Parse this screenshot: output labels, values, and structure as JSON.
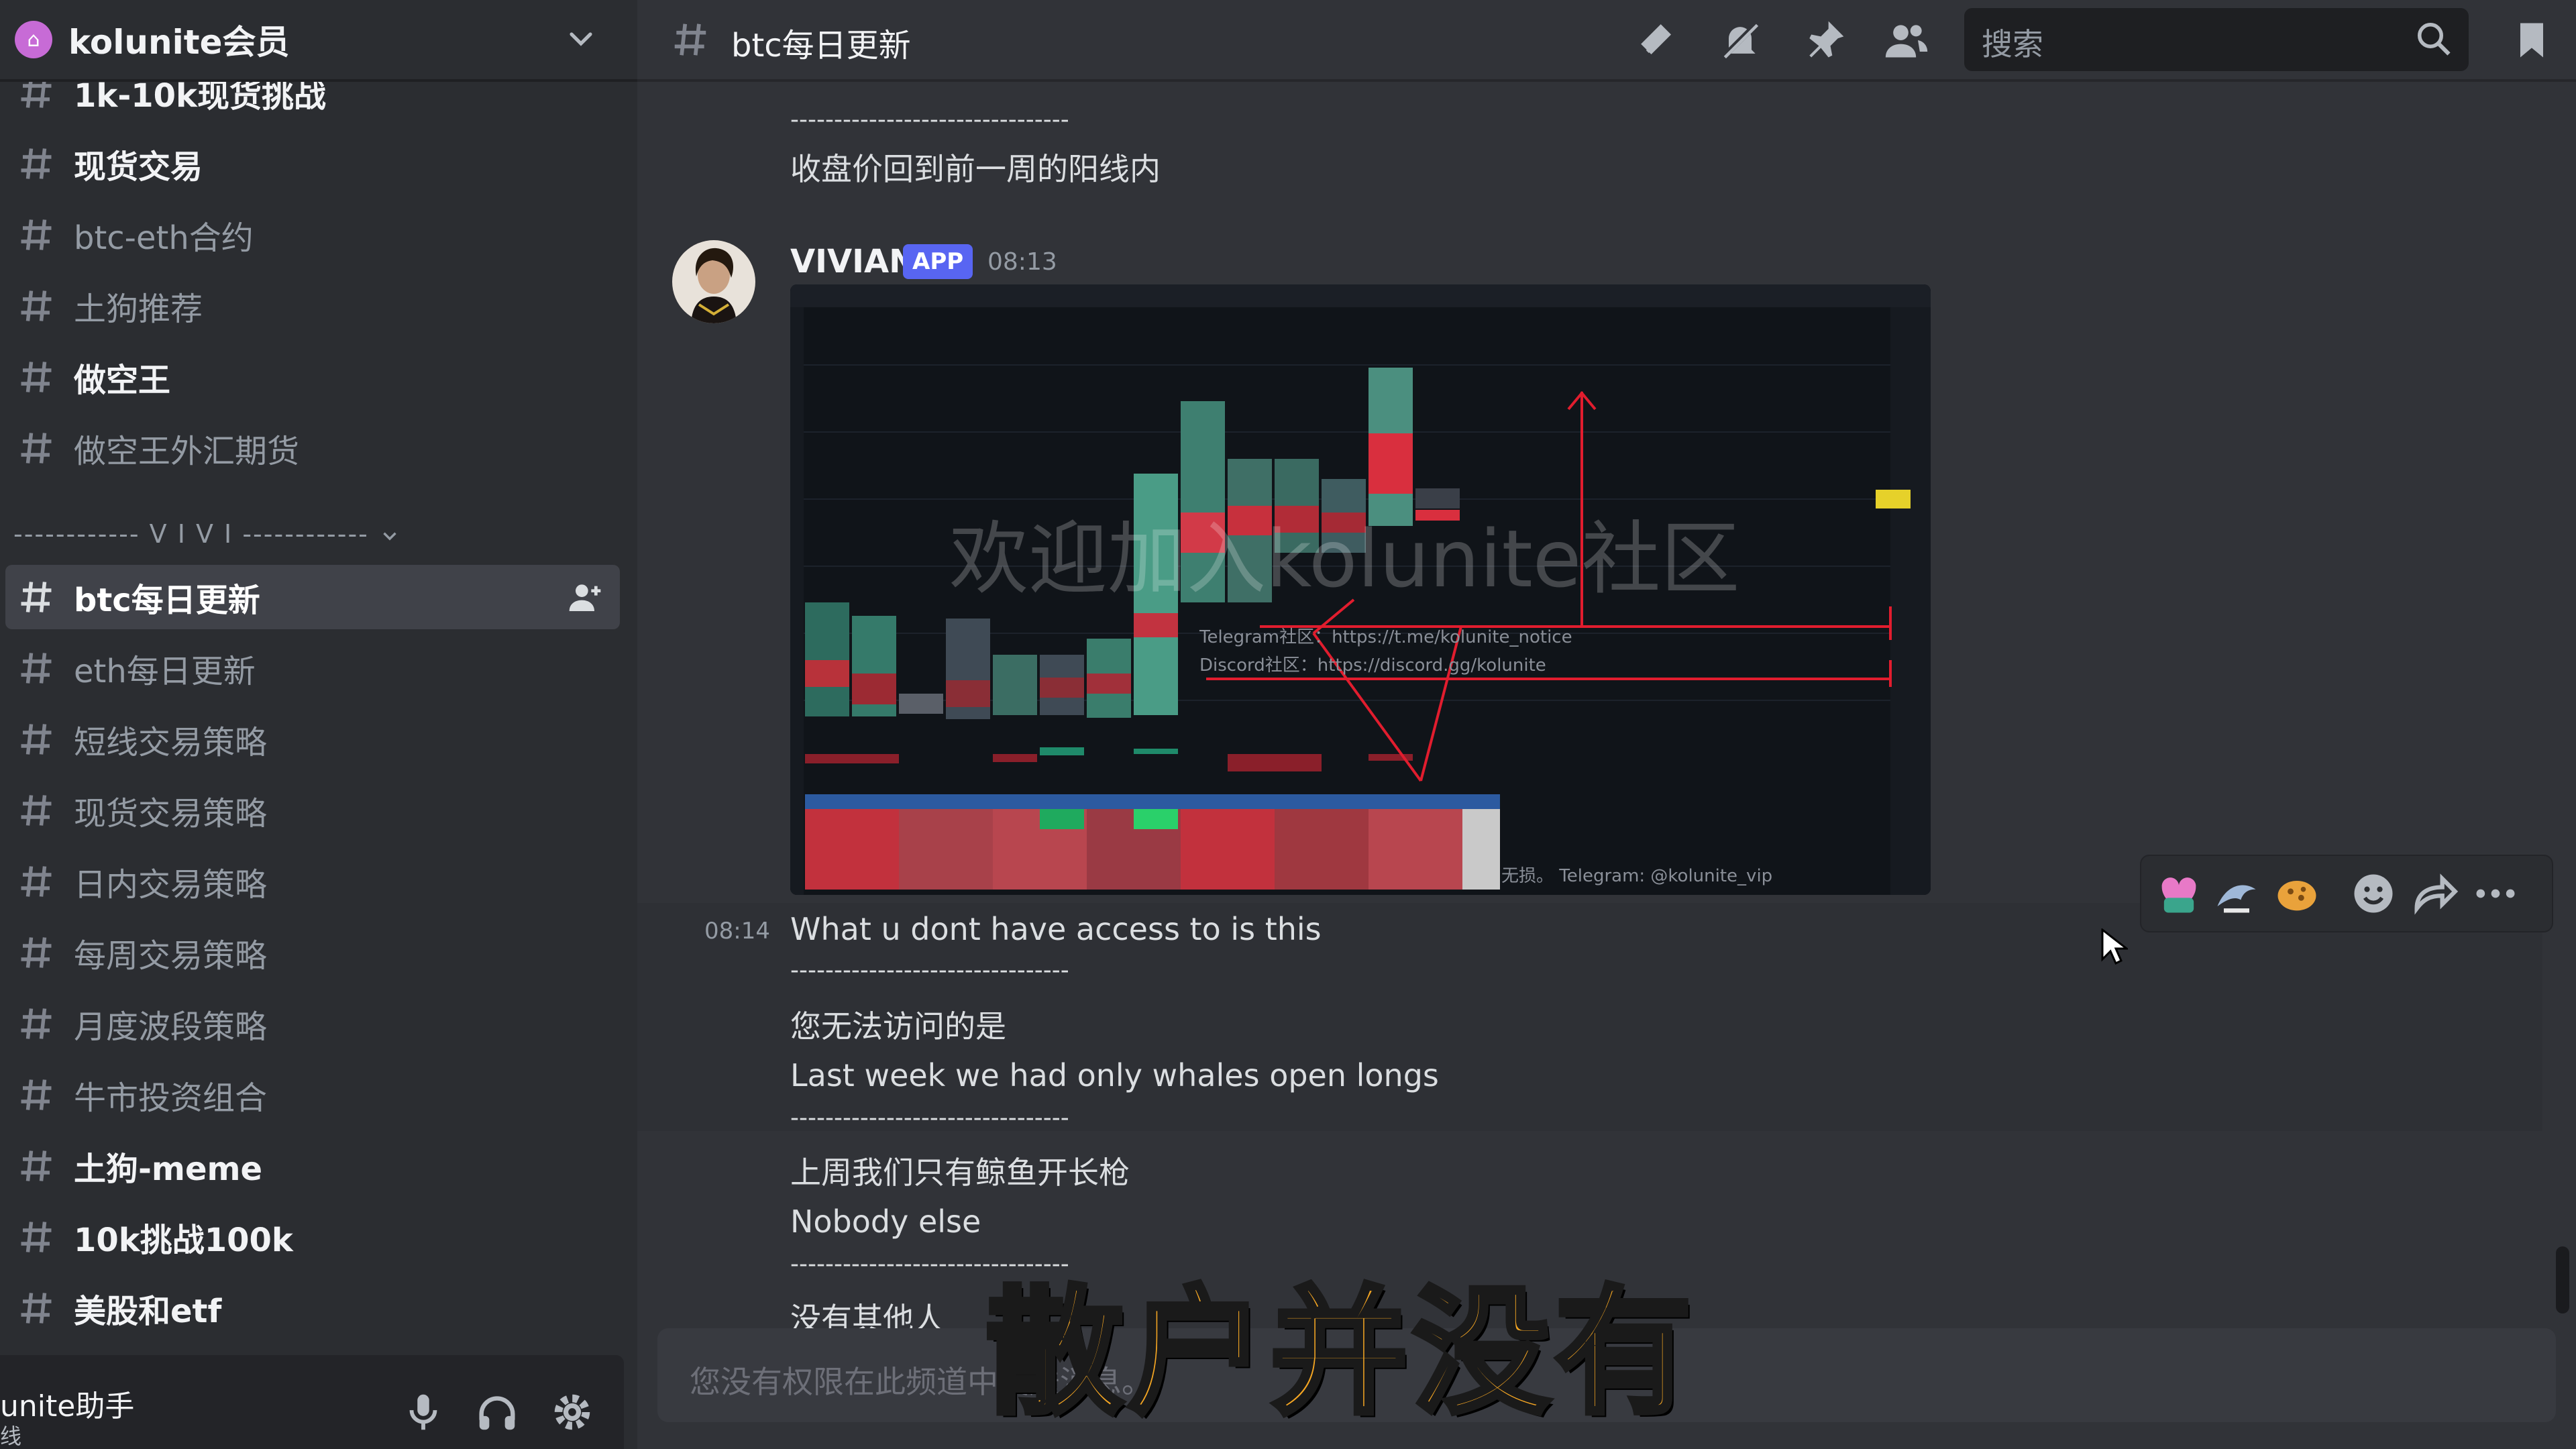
{
  "server": {
    "name": "kolunite会员"
  },
  "channels_top": [
    {
      "label": "1k-10k现货挑战",
      "unread": true
    },
    {
      "label": "现货交易",
      "unread": true
    },
    {
      "label": "btc-eth合约",
      "unread": false
    },
    {
      "label": "土狗推荐",
      "unread": false
    },
    {
      "label": "做空王",
      "unread": true
    },
    {
      "label": "做空王外汇期货",
      "unread": false
    }
  ],
  "category": {
    "label": "------------ V I V I ------------"
  },
  "channels_vivi": [
    {
      "label": "btc每日更新",
      "active": true
    },
    {
      "label": "eth每日更新"
    },
    {
      "label": "短线交易策略"
    },
    {
      "label": "现货交易策略"
    },
    {
      "label": "日内交易策略"
    },
    {
      "label": "每周交易策略"
    },
    {
      "label": "月度波段策略"
    },
    {
      "label": "牛市投资组合"
    },
    {
      "label": "土狗-meme",
      "unread": true
    },
    {
      "label": "10k挑战100k",
      "unread": true
    },
    {
      "label": "美股和etf",
      "unread": true
    }
  ],
  "user_panel": {
    "name": "unite助手",
    "status": "线"
  },
  "header": {
    "channel": "btc每日更新",
    "search_placeholder": "搜索"
  },
  "messages": {
    "prev_dash": "--------------------------------",
    "prev_text": "收盘价回到前一周的阳线内",
    "author": "VIVIAN",
    "badge": "APP",
    "time": "08:13",
    "image_watermark": "欢迎加入kolunite社区",
    "image_tg": "Telegram社区：https://t.me/kolunite_notice",
    "image_dc": "Discord社区：https://discord.gg/kolunite",
    "image_footer": "无损。 Telegram: @kolunite_vip",
    "followup_time": "08:14",
    "lines": [
      "What u dont have access to is this",
      "--------------------------------",
      "您无法访问的是",
      "Last week we had only whales open longs",
      "--------------------------------",
      "上周我们只有鲸鱼开长枪",
      "Nobody else",
      "--------------------------------",
      "没有其他人"
    ]
  },
  "composer": {
    "placeholder": "您没有权限在此频道中发送消息。"
  },
  "subtitle": "散户并没有",
  "colors": {
    "accent": "#5865f2",
    "subtitle": "#f5a623"
  }
}
